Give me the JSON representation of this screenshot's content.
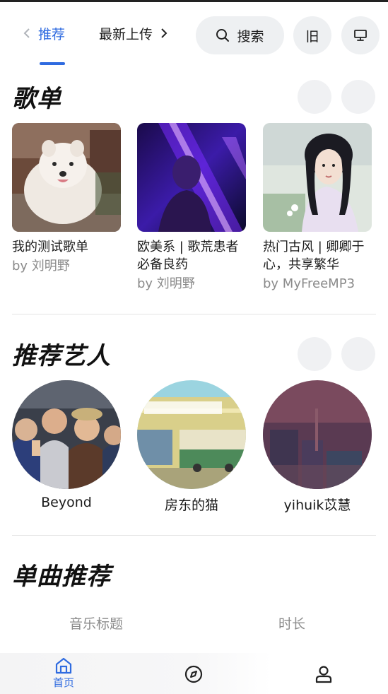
{
  "header": {
    "tabs": [
      {
        "label": "推荐",
        "active": true
      },
      {
        "label": "最新上传",
        "active": false
      }
    ],
    "search_label": "搜索",
    "old_label": "旧"
  },
  "playlists_section": {
    "title": "歌单",
    "items": [
      {
        "title": "我的测试歌单",
        "author": "by 刘明野"
      },
      {
        "title": "欧美系 | 歌荒患者必备良药",
        "author": "by 刘明野"
      },
      {
        "title": "热门古风 | 卿卿于心，共享繁华",
        "author": "by MyFreeMP3"
      }
    ]
  },
  "artists_section": {
    "title": "推荐艺人",
    "items": [
      {
        "name": "Beyond"
      },
      {
        "name": "房东的猫"
      },
      {
        "name": "yihuik苡慧"
      }
    ]
  },
  "songs_section": {
    "title": "单曲推荐",
    "columns": [
      "音乐标题",
      "时长"
    ]
  },
  "bottom_nav": {
    "items": [
      {
        "label": "首页",
        "icon": "home-icon",
        "active": true
      },
      {
        "label": "",
        "icon": "compass-icon",
        "active": false
      },
      {
        "label": "",
        "icon": "user-icon",
        "active": false
      }
    ]
  },
  "colors": {
    "accent": "#2f6be0",
    "pill_bg": "#eef0f2",
    "muted_text": "#8a8a8a"
  }
}
